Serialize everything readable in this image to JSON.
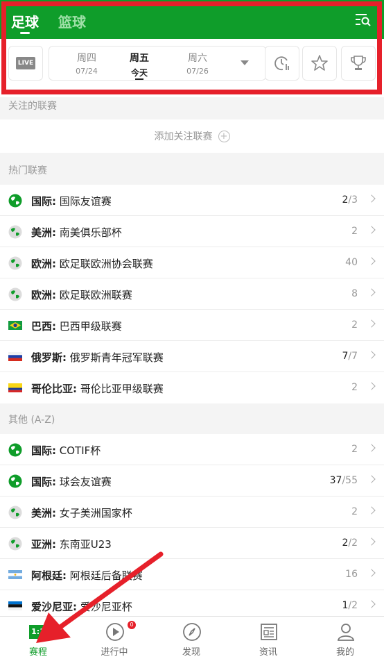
{
  "sport_tabs": {
    "football": "足球",
    "basketball": "篮球"
  },
  "live_label": "LIVE",
  "days": [
    {
      "weekday": "周四",
      "date": "07/24"
    },
    {
      "weekday": "周五",
      "date": "今天"
    },
    {
      "weekday": "周六",
      "date": "07/26"
    }
  ],
  "sections": {
    "followed_title": "关注的联赛",
    "followed_add": "添加关注联赛",
    "hot_title": "热门联赛",
    "other_title": "其他 (A-Z)"
  },
  "hot_leagues": [
    {
      "region": "国际:",
      "name": "国际友谊赛",
      "live": "2",
      "total": "/3",
      "flag": "globe"
    },
    {
      "region": "美洲:",
      "name": "南美俱乐部杯",
      "live": "",
      "total": "2",
      "flag": "globe-americas"
    },
    {
      "region": "欧洲:",
      "name": "欧足联欧洲协会联赛",
      "live": "",
      "total": "40",
      "flag": "globe-europe"
    },
    {
      "region": "欧洲:",
      "name": "欧足联欧洲联赛",
      "live": "",
      "total": "8",
      "flag": "globe-europe"
    },
    {
      "region": "巴西:",
      "name": "巴西甲级联赛",
      "live": "",
      "total": "2",
      "flag": "brazil"
    },
    {
      "region": "俄罗斯:",
      "name": "俄罗斯青年冠军联赛",
      "live": "7",
      "total": "/7",
      "flag": "russia"
    },
    {
      "region": "哥伦比亚:",
      "name": "哥伦比亚甲级联赛",
      "live": "",
      "total": "2",
      "flag": "colombia"
    }
  ],
  "other_leagues": [
    {
      "region": "国际:",
      "name": "COTIF杯",
      "live": "",
      "total": "2",
      "flag": "globe"
    },
    {
      "region": "国际:",
      "name": "球会友谊赛",
      "live": "37",
      "total": "/55",
      "flag": "globe"
    },
    {
      "region": "美洲:",
      "name": "女子美洲国家杯",
      "live": "",
      "total": "2",
      "flag": "globe-americas"
    },
    {
      "region": "亚洲:",
      "name": "东南亚U23",
      "live": "2",
      "total": "/2",
      "flag": "globe-asia"
    },
    {
      "region": "阿根廷:",
      "name": "阿根廷后备联赛",
      "live": "",
      "total": "16",
      "flag": "argentina"
    },
    {
      "region": "爱沙尼亚:",
      "name": "爱沙尼亚杯",
      "live": "1",
      "total": "/2",
      "flag": "estonia"
    }
  ],
  "bottom_nav": [
    {
      "label": "赛程",
      "icon": "score-icon"
    },
    {
      "label": "进行中",
      "icon": "play-icon",
      "badge": "0"
    },
    {
      "label": "发现",
      "icon": "compass-icon"
    },
    {
      "label": "资讯",
      "icon": "news-icon"
    },
    {
      "label": "我的",
      "icon": "user-icon"
    }
  ],
  "bottom_nav_score_text": "1:1",
  "colors": {
    "brand": "#0f9d2a",
    "highlight_frame": "#e6202a",
    "arrow": "#e6202a"
  }
}
